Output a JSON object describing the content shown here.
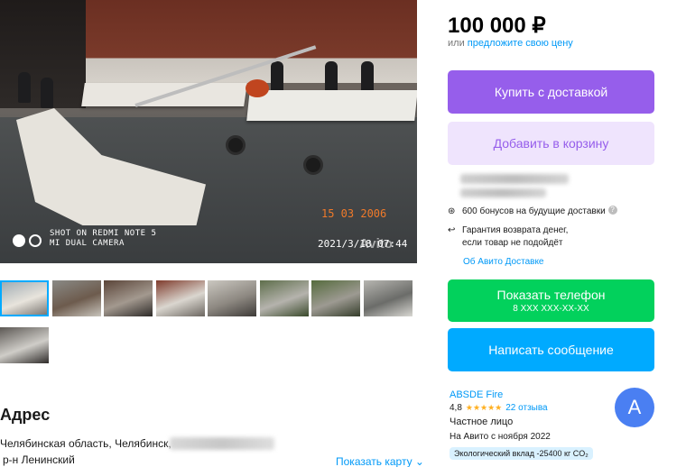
{
  "gallery": {
    "photo_caption_line1": "SHOT ON REDMI NOTE 5",
    "photo_caption_line2": "MI DUAL CAMERA",
    "photo_stamp": "15 03 2006",
    "photo_date": "2021/3/18  07:44",
    "photo_watermark": "Avito",
    "thumbnails": [
      {
        "colors": [
          "#9aa7b0",
          "#e8e4dc",
          "#6e6a66"
        ]
      },
      {
        "colors": [
          "#8a8a86",
          "#6d5b4d",
          "#c8c4bc"
        ]
      },
      {
        "colors": [
          "#5a4438",
          "#a3998f",
          "#2d2a28"
        ]
      },
      {
        "colors": [
          "#7f3b2c",
          "#dad6cf",
          "#6b6660"
        ]
      },
      {
        "colors": [
          "#cbc8c1",
          "#8d8881",
          "#3d3a37"
        ]
      },
      {
        "colors": [
          "#5e6e4b",
          "#b5b3ad",
          "#3a4a2b"
        ]
      },
      {
        "colors": [
          "#556b3d",
          "#9d9a92",
          "#343d2a"
        ]
      },
      {
        "colors": [
          "#b7b6b1",
          "#6b6c69",
          "#d9d8d3"
        ]
      },
      {
        "colors": [
          "#5c5854",
          "#cfcdc8",
          "#2f2c2a"
        ]
      }
    ]
  },
  "address": {
    "title": "Адрес",
    "line1": "Челябинская область, Челябинск,",
    "line2": "р-н Ленинский",
    "map_link": "Показать карту"
  },
  "offer": {
    "price": "100 000 ₽",
    "price_sub_prefix": "или ",
    "price_sub_link": "предложите свою цену",
    "buy_button": "Купить с доставкой",
    "cart_button": "Добавить в корзину",
    "bonus_text": "600 бонусов на будущие доставки",
    "guarantee_text": "Гарантия возврата денег, если товар не подойдёт",
    "delivery_link": "Об Авито Доставке",
    "phone_button": "Показать телефон",
    "phone_masked": "8 XXX XXX-XX-XX",
    "message_button": "Написать сообщение"
  },
  "seller": {
    "name": "ABSDE Fire",
    "rating": "4,8",
    "stars": "★★★★★",
    "reviews": "22 отзыва",
    "type": "Частное лицо",
    "since": "На Авито с ноября 2022",
    "eco": "Экологический вклад -25400 кг CO₂",
    "avatar_letter": "A"
  },
  "colors": {
    "buy": "#965eeb",
    "cart_bg": "#efe4fd",
    "phone": "#02d15c",
    "message": "#00aaff",
    "link": "#0099f7",
    "avatar": "#4a7ff2"
  }
}
